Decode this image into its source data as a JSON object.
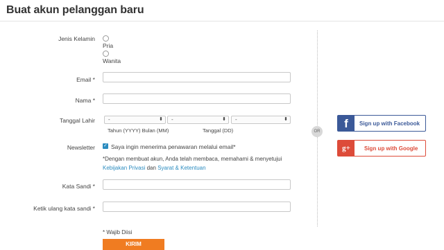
{
  "page": {
    "title": "Buat akun pelanggan baru"
  },
  "form": {
    "gender": {
      "label": "Jenis Kelamin",
      "options": [
        "Pria",
        "Wanita"
      ]
    },
    "email": {
      "label": "Email *",
      "value": ""
    },
    "name": {
      "label": "Nama *",
      "value": ""
    },
    "birthdate": {
      "label": "Tanggal Lahir",
      "year": {
        "value": "-"
      },
      "month": {
        "value": "-"
      },
      "day": {
        "value": "-"
      },
      "hint_year_month": "Tahun (YYYY) Bulan (MM)",
      "hint_day": "Tanggal (DD)"
    },
    "newsletter": {
      "label": "Newsletter",
      "checkbox_text": "Saya ingin menerima penawaran melalui email*",
      "checked": true
    },
    "terms": {
      "text": "*Dengan membuat akun, Anda telah membaca, memahami & menyetujui",
      "privacy_link": "Kebijakan Privasi",
      "conjunction": "dan",
      "terms_link": "Syarat & Ketentuan"
    },
    "password": {
      "label": "Kata Sandi *",
      "value": ""
    },
    "password_confirm": {
      "label": "Ketik ulang kata sandi *",
      "value": ""
    },
    "required_note": "* Wajib Diisi",
    "submit_label": "KIRIM"
  },
  "divider": {
    "or_label": "OR"
  },
  "social": {
    "facebook": {
      "icon": "f",
      "label": "Sign up with Facebook",
      "color": "#3b5998"
    },
    "google": {
      "icon": "g+",
      "label": "Sign up with Google",
      "color": "#dd4b39"
    }
  },
  "colors": {
    "accent": "#f07c21",
    "link": "#2a8bbf"
  }
}
